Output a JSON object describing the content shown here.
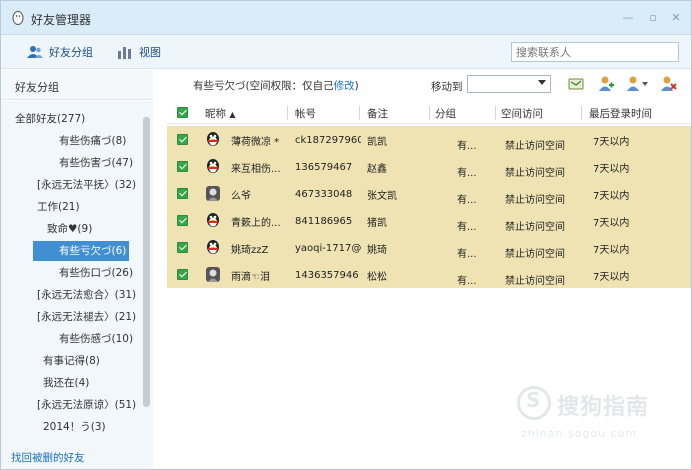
{
  "window": {
    "title": "好友管理器"
  },
  "toolbar": {
    "group_btn_label": "好友分组",
    "view_btn_label": "视图",
    "search_placeholder": "搜索联系人"
  },
  "left_panel": {
    "header": "好友分组",
    "tree": [
      {
        "label": "全部好友(277)",
        "indent": 0,
        "selected": false
      },
      {
        "label": "有些伤痛づ(8)",
        "indent": 2,
        "selected": false
      },
      {
        "label": "有些伤害づ(47)",
        "indent": 2,
        "selected": false
      },
      {
        "label": "[永远无法平抚〉(32)",
        "indent": 1,
        "selected": false
      },
      {
        "label": "工作(21)",
        "indent": 1,
        "selected": false
      },
      {
        "label": "致命♥(9)",
        "indent": 2,
        "selected": false
      },
      {
        "label": "有些亏欠づ(6)",
        "indent": 2,
        "selected": true
      },
      {
        "label": "有些伤口づ(26)",
        "indent": 2,
        "selected": false
      },
      {
        "label": "[永远无法愈合〉(31)",
        "indent": 1,
        "selected": false
      },
      {
        "label": "[永远无法褪去〉(21)",
        "indent": 1,
        "selected": false
      },
      {
        "label": "有些伤感づ(10)",
        "indent": 2,
        "selected": false
      },
      {
        "label": "有事记得(8)",
        "indent": 1,
        "selected": false
      },
      {
        "label": "我还在(4)",
        "indent": 1,
        "selected": false
      },
      {
        "label": "[永远无法原谅〉(51)",
        "indent": 1,
        "selected": false
      },
      {
        "label": "2014！う(3)",
        "indent": 1,
        "selected": false
      }
    ],
    "footer_link": "找回被删的好友"
  },
  "group_info": {
    "prefix": "有些亏欠づ(空间权限：仅自己",
    "link": "修改",
    "suffix": ")"
  },
  "move_to": {
    "label": "移动到",
    "value": ""
  },
  "table": {
    "columns": [
      "昵称",
      "帐号",
      "备注",
      "分组",
      "空间访问",
      "最后登录时间"
    ],
    "sort_indicator": "▲",
    "rows": [
      {
        "nickname": "薄荷微凉 *",
        "account": "ck187297960...",
        "remark": "凯凯",
        "group": "有...",
        "access": "禁止访问空间",
        "last_login": "7天以内",
        "avatar": "qq-penguin-icon"
      },
      {
        "nickname": "来互相伤...",
        "account": "136579467",
        "remark": "赵鑫",
        "group": "有...",
        "access": "禁止访问空间",
        "last_login": "7天以内",
        "avatar": "qq-penguin-icon"
      },
      {
        "nickname": "么爷",
        "account": "467333048",
        "remark": "张文凯",
        "group": "有...",
        "access": "禁止访问空间",
        "last_login": "7天以内",
        "avatar": "photo-avatar-icon"
      },
      {
        "nickname": "青簌上的...",
        "account": "841186965",
        "remark": "猪凯",
        "group": "有...",
        "access": "禁止访问空间",
        "last_login": "7天以内",
        "avatar": "qq-penguin-icon"
      },
      {
        "nickname": "姚琦zzZ",
        "account": "yaoqi-1717@...",
        "remark": "姚琦",
        "group": "有...",
        "access": "禁止访问空间",
        "last_login": "7天以内",
        "avatar": "qq-penguin-icon"
      },
      {
        "nickname": "雨滴☜泪",
        "account": "1436357946",
        "remark": "松松",
        "group": "有...",
        "access": "禁止访问空间",
        "last_login": "7天以内",
        "avatar": "photo-avatar-icon"
      }
    ]
  },
  "watermark": {
    "text": "搜狗指南",
    "url": "zhinan.sogou.com"
  },
  "colors": {
    "row_bg": "#efe3b3",
    "selected": "#3f8fd2",
    "check": "#35a64a",
    "link": "#1a6fc0"
  }
}
